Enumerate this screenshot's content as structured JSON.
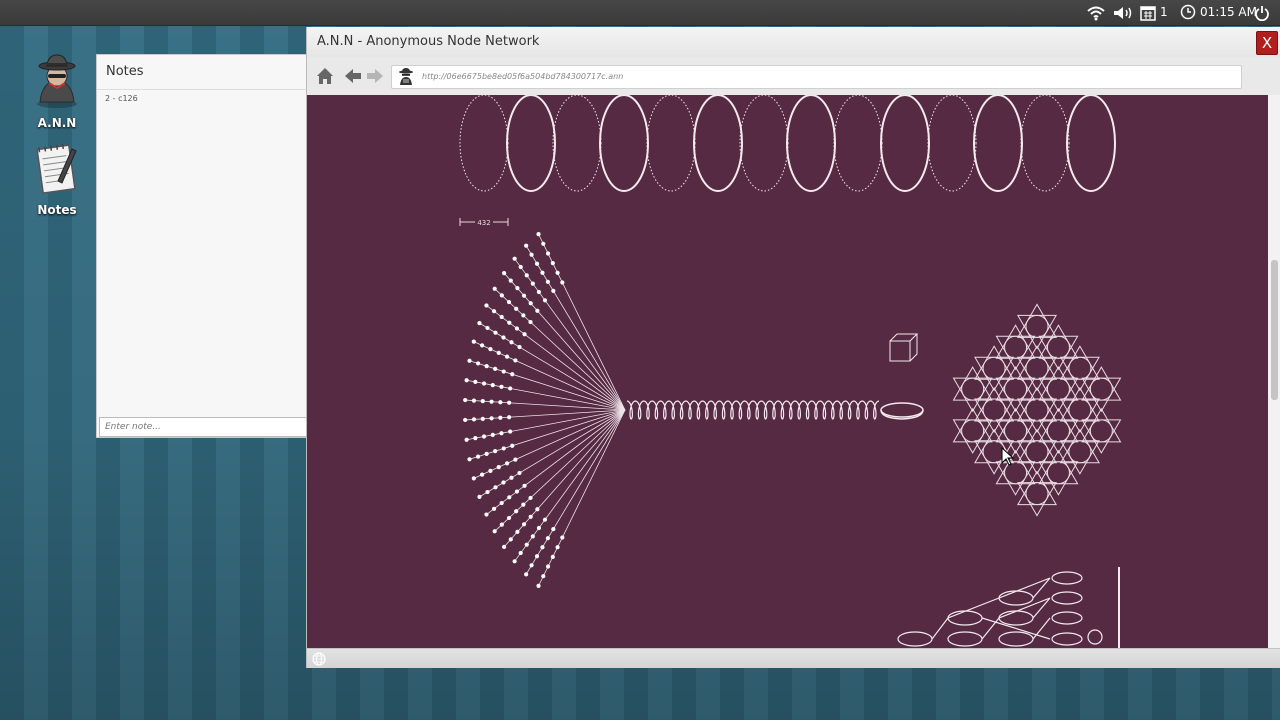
{
  "top_panel": {
    "icons": [
      "wifi-icon",
      "volume-icon",
      "calendar-icon",
      "clock-icon",
      "power-icon"
    ],
    "count": "1",
    "time": "01:15 AM"
  },
  "desktop": {
    "icons": [
      {
        "label": "A.N.N",
        "icon": "anonymous-agent-icon"
      },
      {
        "label": "Notes",
        "icon": "notepad-icon"
      }
    ]
  },
  "notes_window": {
    "title": "Notes",
    "items": [
      "2 - c126"
    ],
    "input_placeholder": "Enter note..."
  },
  "browser": {
    "title": "A.N.N - Anonymous Node Network",
    "close_label": "X",
    "url": "http://06e6675be8ed05f6a504bd784300717c.ann",
    "toolbar_icons": [
      "home-icon",
      "back-icon",
      "forward-icon",
      "agent-icon"
    ],
    "status_icons": [
      "globe-icon"
    ]
  },
  "content": {
    "scale_label": "432",
    "background": "#562a42"
  },
  "colors": {
    "close": "#b01e1e",
    "content_bg": "#562a42",
    "desktop_stripe": "#3a7186"
  }
}
